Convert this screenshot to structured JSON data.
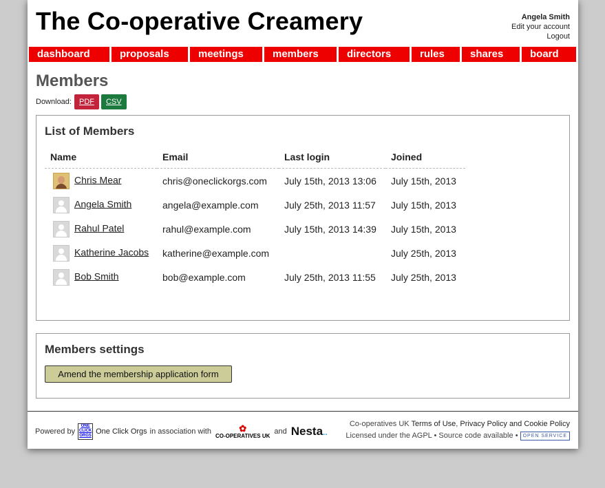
{
  "site": {
    "title": "The Co-operative Creamery"
  },
  "user": {
    "name": "Angela Smith",
    "edit_account": "Edit your account",
    "logout": "Logout"
  },
  "nav": [
    {
      "label": "dashboard"
    },
    {
      "label": "proposals"
    },
    {
      "label": "meetings"
    },
    {
      "label": "members"
    },
    {
      "label": "directors"
    },
    {
      "label": "rules"
    },
    {
      "label": "shares"
    },
    {
      "label": "board"
    }
  ],
  "page": {
    "heading": "Members"
  },
  "download": {
    "label": "Download:",
    "pdf": "PDF",
    "csv": "CSV"
  },
  "members_list": {
    "heading": "List of Members",
    "columns": {
      "name": "Name",
      "email": "Email",
      "last_login": "Last login",
      "joined": "Joined"
    },
    "rows": [
      {
        "name": "Chris Mear",
        "email": "chris@oneclickorgs.com",
        "last_login": "July 15th, 2013 13:06",
        "joined": "July 15th, 2013",
        "avatar": "photo"
      },
      {
        "name": "Angela Smith",
        "email": "angela@example.com",
        "last_login": "July 25th, 2013 11:57",
        "joined": "July 15th, 2013",
        "avatar": "default"
      },
      {
        "name": "Rahul Patel",
        "email": "rahul@example.com",
        "last_login": "July 15th, 2013 14:39",
        "joined": "July 15th, 2013",
        "avatar": "default"
      },
      {
        "name": "Katherine Jacobs",
        "email": "katherine@example.com",
        "last_login": "",
        "joined": "July 25th, 2013",
        "avatar": "default"
      },
      {
        "name": "Bob Smith",
        "email": "bob@example.com",
        "last_login": "July 25th, 2013 11:55",
        "joined": "July 25th, 2013",
        "avatar": "default"
      }
    ]
  },
  "members_settings": {
    "heading": "Members settings",
    "amend_button": "Amend the membership application form"
  },
  "footer": {
    "powered_by": "Powered by",
    "oco_logo_text": "ONE CLICK ORGS",
    "oco_name": "One Click Orgs",
    "association": "in association with",
    "coops_logo_text": "CO-OPERATIVES UK",
    "and": "and",
    "nesta": "Nesta",
    "coops_uk": "Co-operatives UK",
    "terms": "Terms of Use",
    "privacy": "Privacy Policy and Cookie Policy",
    "licensed": "Licensed under the",
    "agpl": "AGPL",
    "source": "Source code available",
    "open_service": "OPEN SERVICE"
  },
  "colors": {
    "nav_bg": "#ee0000",
    "pdf_button": "#c4243b",
    "csv_button": "#1d7a3f",
    "settings_button": "#cccc99"
  }
}
